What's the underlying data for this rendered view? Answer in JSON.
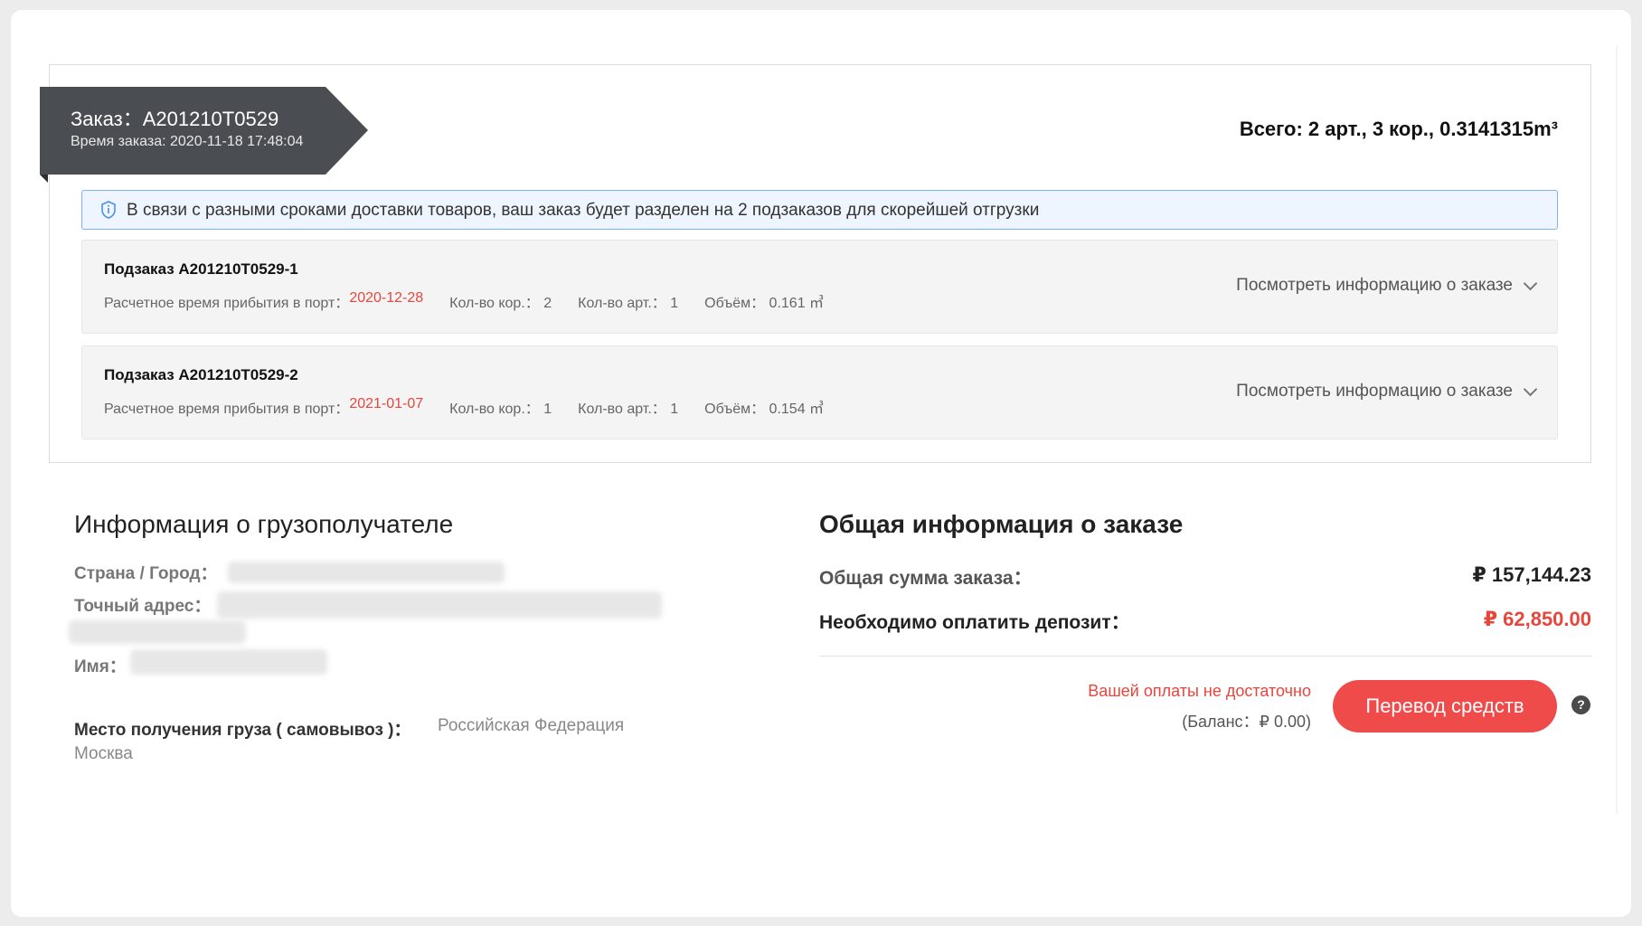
{
  "order": {
    "title": "Заказ：A201210T0529",
    "time": "Время заказа: 2020-11-18 17:48:04",
    "total": "Всего: 2 арт., 3 кор., 0.3141315m³"
  },
  "notice": {
    "text": "В связи с разными сроками доставки товаров, ваш заказ будет разделен на 2 подзаказов для скорейшей отгрузки"
  },
  "suborders": [
    {
      "title": "Подзаказ A201210T0529-1",
      "eta_label": "Расчетное время прибытия в порт：",
      "eta_value": "2020-12-28",
      "boxes": "Кол-во кор.： 2",
      "items": "Кол-во арт.： 1",
      "volume": "Объём： 0.161 ㎥",
      "link": "Посмотреть информацию о заказе"
    },
    {
      "title": "Подзаказ A201210T0529-2",
      "eta_label": "Расчетное время прибытия в порт：",
      "eta_value": "2021-01-07",
      "boxes": "Кол-во кор.： 1",
      "items": "Кол-во арт.： 1",
      "volume": "Объём： 0.154 ㎥",
      "link": "Посмотреть информацию о заказе"
    }
  ],
  "recipient": {
    "title": "Информация о грузополучателе",
    "country_label": "Страна / Город：",
    "address_label": "Точный адрес：",
    "name_label": "Имя：",
    "pickup_label": "Место получения груза ( самовывоз )：",
    "pickup_country": "Российская Федерация",
    "pickup_city": "Москва"
  },
  "summary": {
    "title": "Общая информация о заказе",
    "total_label": "Общая сумма заказа：",
    "total_value": "₽ 157,144.23",
    "deposit_label": "Необходимо оплатить депозит：",
    "deposit_value": "₽ 62,850.00",
    "warning": "Вашей оплаты не достаточно",
    "balance": "(Баланс：₽ 0.00)",
    "transfer_button": "Перевод средств",
    "help_icon": "?"
  },
  "colors": {
    "accent_red": "#f04b4b",
    "tag_dark": "#4a4d52",
    "notice_border": "#7fb2ee"
  }
}
